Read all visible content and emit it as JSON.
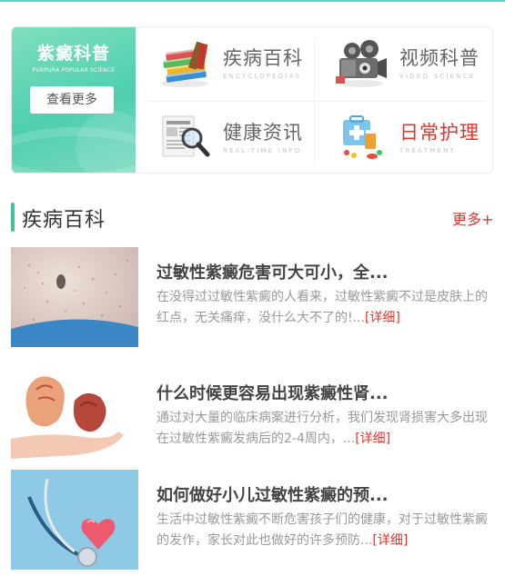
{
  "promo": {
    "title": "紫癜科普",
    "subtitle": "PURPURA POPULAR SCIENCE",
    "button": "查看更多"
  },
  "categories": [
    {
      "label": "疾病百科",
      "en": "ENCYCLOPEDIAS",
      "icon": "books-icon",
      "color": "#666666"
    },
    {
      "label": "视频科普",
      "en": "VIDEO SCIENCE",
      "icon": "film-camera-icon",
      "color": "#666666"
    },
    {
      "label": "健康资讯",
      "en": "REAL-TIME INFO",
      "icon": "newspaper-magnifier-icon",
      "color": "#666666"
    },
    {
      "label": "日常护理",
      "en": "TREATMENT",
      "icon": "medical-kit-icon",
      "color": "#e6332a"
    }
  ],
  "section": {
    "title": "疾病百科",
    "more": "更多+"
  },
  "articles": [
    {
      "title": "过敏性紫癜危害可大可小，全...",
      "desc": "在没得过过敏性紫癜的人看来，过敏性紫癜不过是皮肤上的红点，无关痛痒，没什么大不了的!...",
      "detail": "[详细]"
    },
    {
      "title": "什么时候更容易出现紫癜性肾...",
      "desc": "通过对大量的临床病案进行分析，我们发现肾损害大多出现在过敏性紫癜发病后的2-4周内，...",
      "detail": "[详细]"
    },
    {
      "title": "如何做好小儿过敏性紫癜的预...",
      "desc": "生活中过敏性紫癜不断危害孩子们的健康，对于过敏性紫癜的发作，家长对此也做好的许多预防...",
      "detail": "[详细]"
    }
  ],
  "colors": {
    "accent": "#3fc59d",
    "red": "#e6332a",
    "promo_bg": "#5cd4b2"
  }
}
